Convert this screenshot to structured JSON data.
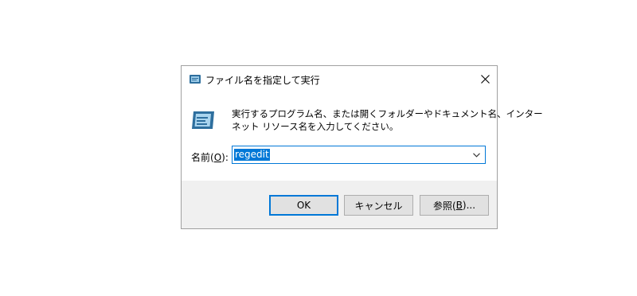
{
  "dialog": {
    "title": "ファイル名を指定して実行",
    "description_line1": "実行するプログラム名、または開くフォルダーやドキュメント名、インター",
    "description_line2": "ネット リソース名を入力してください。",
    "open_label_prefix": "名前(",
    "open_label_mnemonic": "O",
    "open_label_suffix": "):",
    "input_value": "regedit",
    "ok_label": "OK",
    "cancel_label": "キャンセル",
    "browse_label_prefix": "参照(",
    "browse_label_mnemonic": "B",
    "browse_label_suffix": ")..."
  },
  "icons": {
    "title_icon": "run-icon",
    "big_icon": "run-icon",
    "close": "close-icon",
    "dropdown": "chevron-down-icon"
  },
  "colors": {
    "accent": "#0078d7",
    "footer_bg": "#f0f0f0",
    "button_bg": "#e1e1e1"
  }
}
